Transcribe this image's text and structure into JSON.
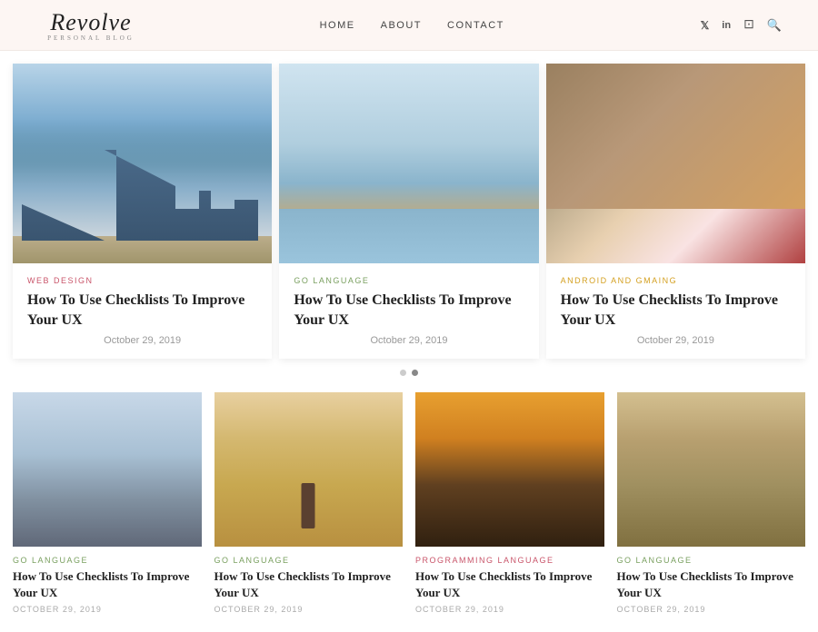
{
  "header": {
    "logo": "Revolve",
    "logo_sub": "PERSONAL BLOG",
    "nav": [
      {
        "label": "HOME",
        "href": "#"
      },
      {
        "label": "ABOUT",
        "href": "#"
      },
      {
        "label": "CONTACT",
        "href": "#"
      }
    ],
    "icons": [
      "facebook-icon",
      "twitter-icon",
      "linkedin-icon",
      "instagram-icon",
      "search-icon"
    ]
  },
  "carousel": {
    "cards": [
      {
        "category": "WEB DESIGN",
        "category_color": "pink",
        "title": "How To Use Checklists To Improve Your UX",
        "date": "October 29, 2019",
        "img_type": "city"
      },
      {
        "category": "GO LANGUAGE",
        "category_color": "green",
        "title": "How To Use Checklists To Improve Your UX",
        "date": "October 29, 2019",
        "img_type": "boat"
      },
      {
        "category": "ANDROID AND GMAING",
        "category_color": "android",
        "title": "How To Use Checklists To Improve Your UX",
        "date": "October 29, 2019",
        "img_type": "drinks"
      }
    ],
    "dots": [
      {
        "active": false
      },
      {
        "active": true
      }
    ]
  },
  "articles": {
    "cards": [
      {
        "category": "GO LANGUAGE",
        "category_color": "green",
        "title": "How To Use Checklists To Improve Your UX",
        "date": "OCTOBER 29, 2019",
        "img_type": "harbor"
      },
      {
        "category": "GO LANGUAGE",
        "category_color": "green",
        "title": "How To Use Checklists To Improve Your UX",
        "date": "OCTOBER 29, 2019",
        "img_type": "desert"
      },
      {
        "category": "PROGRAMMING LANGUAGE",
        "category_color": "pink",
        "title": "How To Use Checklists To Improve Your UX",
        "date": "OCTOBER 29, 2019",
        "img_type": "bridge"
      },
      {
        "category": "GO LANGUAGE",
        "category_color": "green",
        "title": "How To Use Checklists To Improve Your UX",
        "date": "OCTOBER 29, 2019",
        "img_type": "structure"
      }
    ]
  }
}
